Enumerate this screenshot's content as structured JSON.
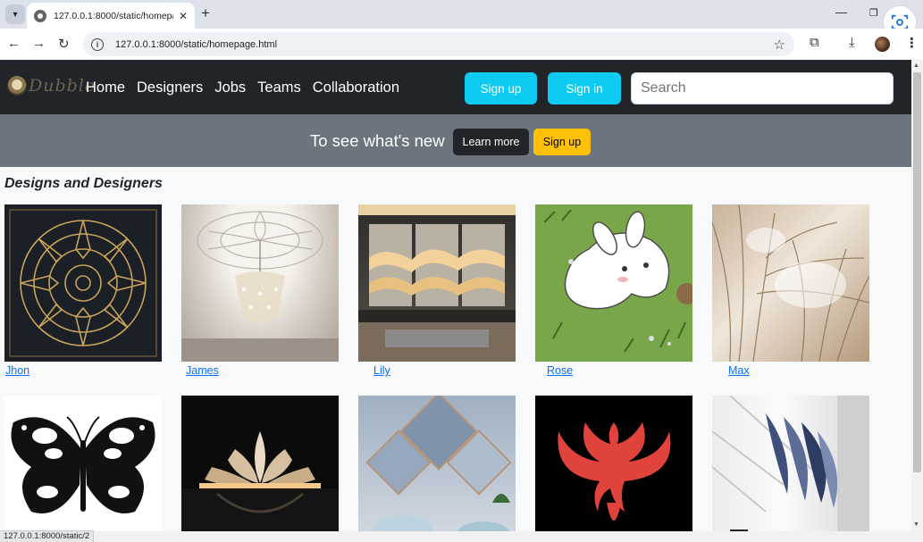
{
  "browser": {
    "tab_title": "127.0.0.1:8000/static/homepage",
    "url": "127.0.0.1:8000/static/homepage.html",
    "status_url": "127.0.0.1:8000/static/2"
  },
  "site": {
    "logo_text": "Dubble",
    "nav_links": [
      "Home",
      "Designers",
      "Jobs",
      "Teams",
      "Collaboration"
    ],
    "signup_label": "Sign up",
    "signin_label": "Sign in",
    "search_placeholder": "Search"
  },
  "banner": {
    "text": "To see what's new",
    "learn_more": "Learn more",
    "signup": "Sign up"
  },
  "gallery": {
    "title": "Designs and Designers",
    "row1": [
      "Jhon",
      "James",
      "Lily",
      "Rose",
      "Max"
    ]
  },
  "colors": {
    "navbar_bg": "#212529",
    "banner_bg": "#6c757d",
    "btn_cyan": "#0dcaf0",
    "btn_warning": "#ffc107",
    "link": "#0d6efd"
  }
}
